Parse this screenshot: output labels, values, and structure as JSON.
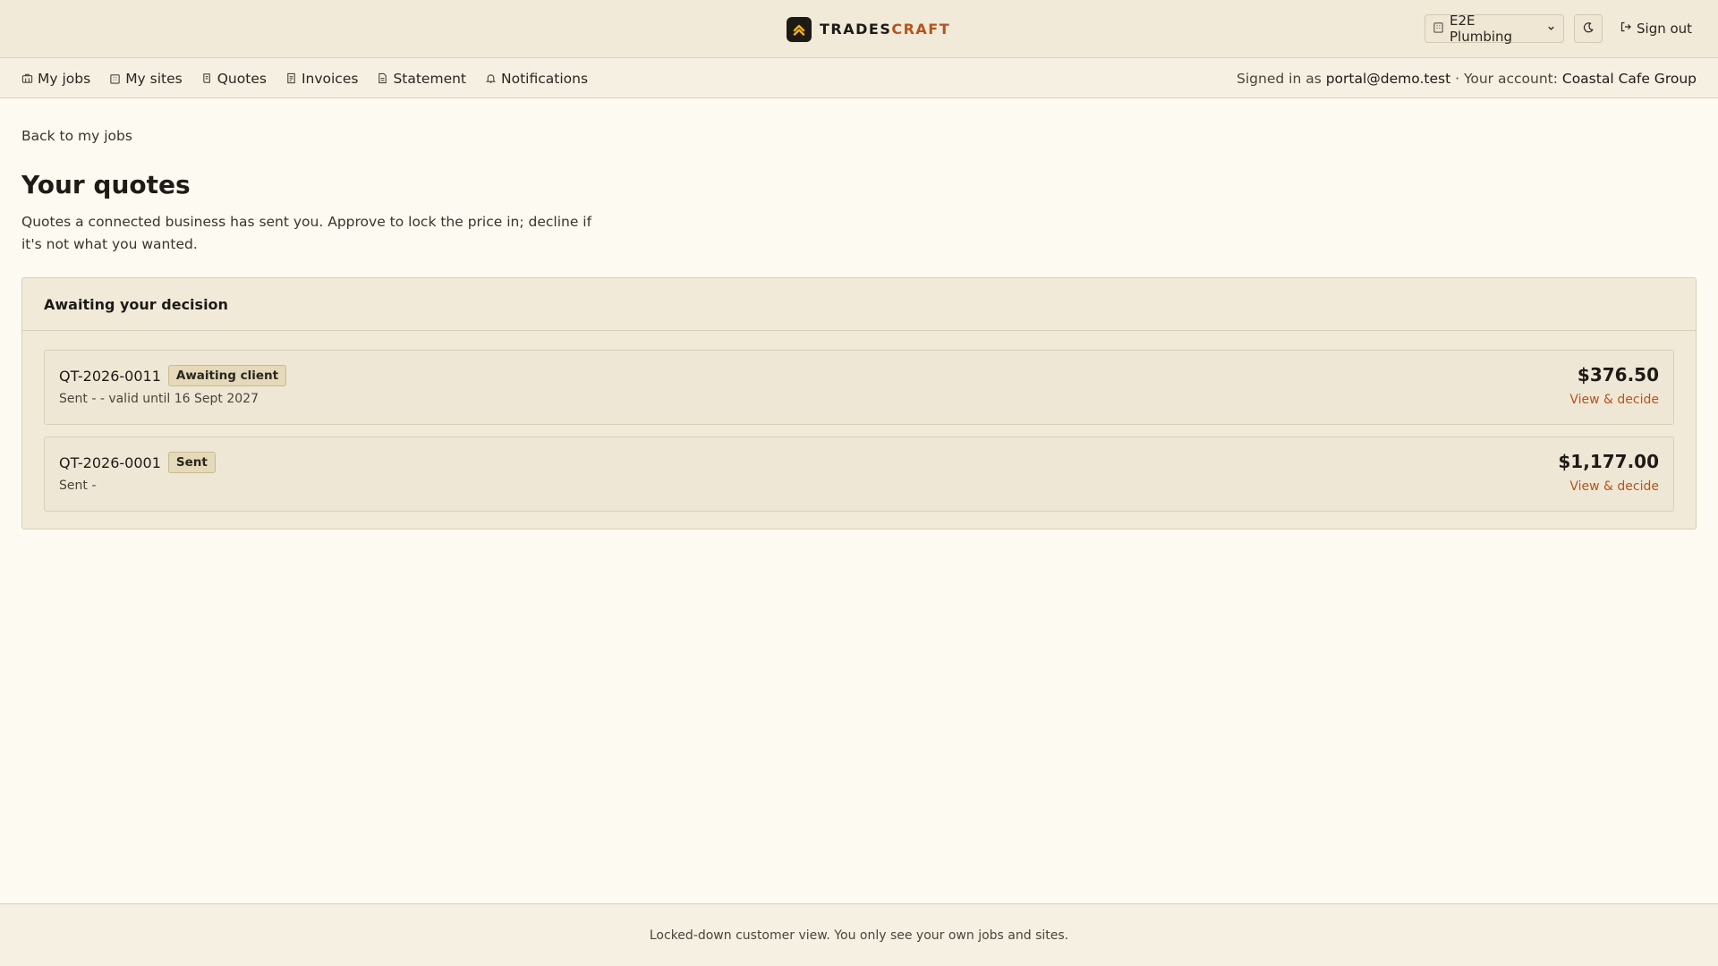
{
  "header": {
    "brand_part1": "TRADES",
    "brand_part2": "CRAFT",
    "tenant": "E2E Plumbing",
    "sign_out": "Sign out",
    "brand_color": "#b5541d"
  },
  "nav": {
    "items": [
      {
        "label": "My jobs",
        "icon": "briefcase-icon"
      },
      {
        "label": "My sites",
        "icon": "building-icon"
      },
      {
        "label": "Quotes",
        "icon": "scroll-icon"
      },
      {
        "label": "Invoices",
        "icon": "receipt-icon"
      },
      {
        "label": "Statement",
        "icon": "document-icon"
      },
      {
        "label": "Notifications",
        "icon": "bell-icon"
      }
    ],
    "signed_in_prefix": "Signed in as ",
    "signed_in_email": "portal@demo.test",
    "account_prefix": " · Your account: ",
    "account_name": "Coastal Cafe Group"
  },
  "main": {
    "back_link": "Back to my jobs",
    "title": "Your quotes",
    "description": "Quotes a connected business has sent you. Approve to lock the price in; decline if it's not what you wanted.",
    "panel_title": "Awaiting your decision",
    "quotes": [
      {
        "number": "QT-2026-0011",
        "status": "Awaiting client",
        "sub": "Sent - - valid until 16 Sept 2027",
        "amount": "$376.50",
        "action": "View & decide"
      },
      {
        "number": "QT-2026-0001",
        "status": "Sent",
        "sub": "Sent -",
        "amount": "$1,177.00",
        "action": "View & decide"
      }
    ]
  },
  "footer": {
    "text": "Locked-down customer view. You only see your own jobs and sites."
  }
}
